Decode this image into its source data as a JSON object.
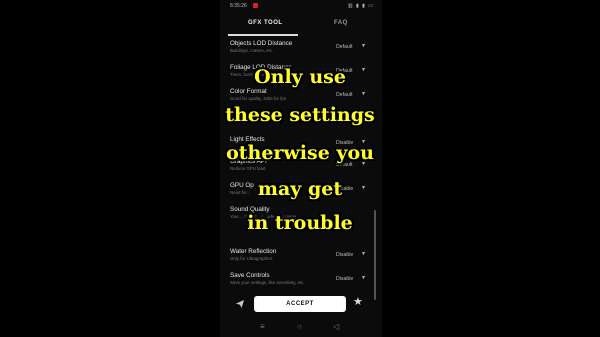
{
  "status_bar": {
    "time": "8:35:26",
    "indicators": "▥ ▮ ▮ ▭"
  },
  "tabs": [
    {
      "label": "GFX TOOL"
    },
    {
      "label": "FAQ"
    }
  ],
  "settings": [
    {
      "title": "Objects LOD Distance",
      "sub": "Buildings, craters, etc.",
      "value": "Default"
    },
    {
      "title": "Foliage LOD Distance",
      "sub": "Trees, bushes, etc.",
      "value": "Default"
    },
    {
      "title": "Color Format",
      "sub": "Good for quality, 32bit for fps",
      "value": "Default"
    },
    {
      "title": "",
      "sub": "...for performance",
      "value": ""
    },
    {
      "title": "Light Effects",
      "sub": "",
      "value": "Disable"
    },
    {
      "title": "Graphics API",
      "sub": "Reduce GPU load",
      "value": "Default"
    },
    {
      "title": "GPU Op",
      "sub": "Need for...",
      "value": "Disable"
    },
    {
      "title": "Sound Quality",
      "sub": "Your... / Need... / ...when... / game",
      "value": ""
    },
    {
      "title": "Water Reflection",
      "sub": "Only for Ultragraphics",
      "value": "Disable"
    },
    {
      "title": "Save Controls",
      "sub": "Save your settings, like sensitivity, etc.",
      "value": "Disable"
    }
  ],
  "bottom": {
    "accept_label": "ACCEPT",
    "star_glyph": "★"
  },
  "overlay": {
    "lines": [
      "Only use",
      "these settings",
      "otherwise you",
      "may get",
      "in trouble"
    ],
    "color": "#ffff2a"
  },
  "nav": {
    "menu": "≡",
    "home": "○",
    "back": "◁"
  }
}
